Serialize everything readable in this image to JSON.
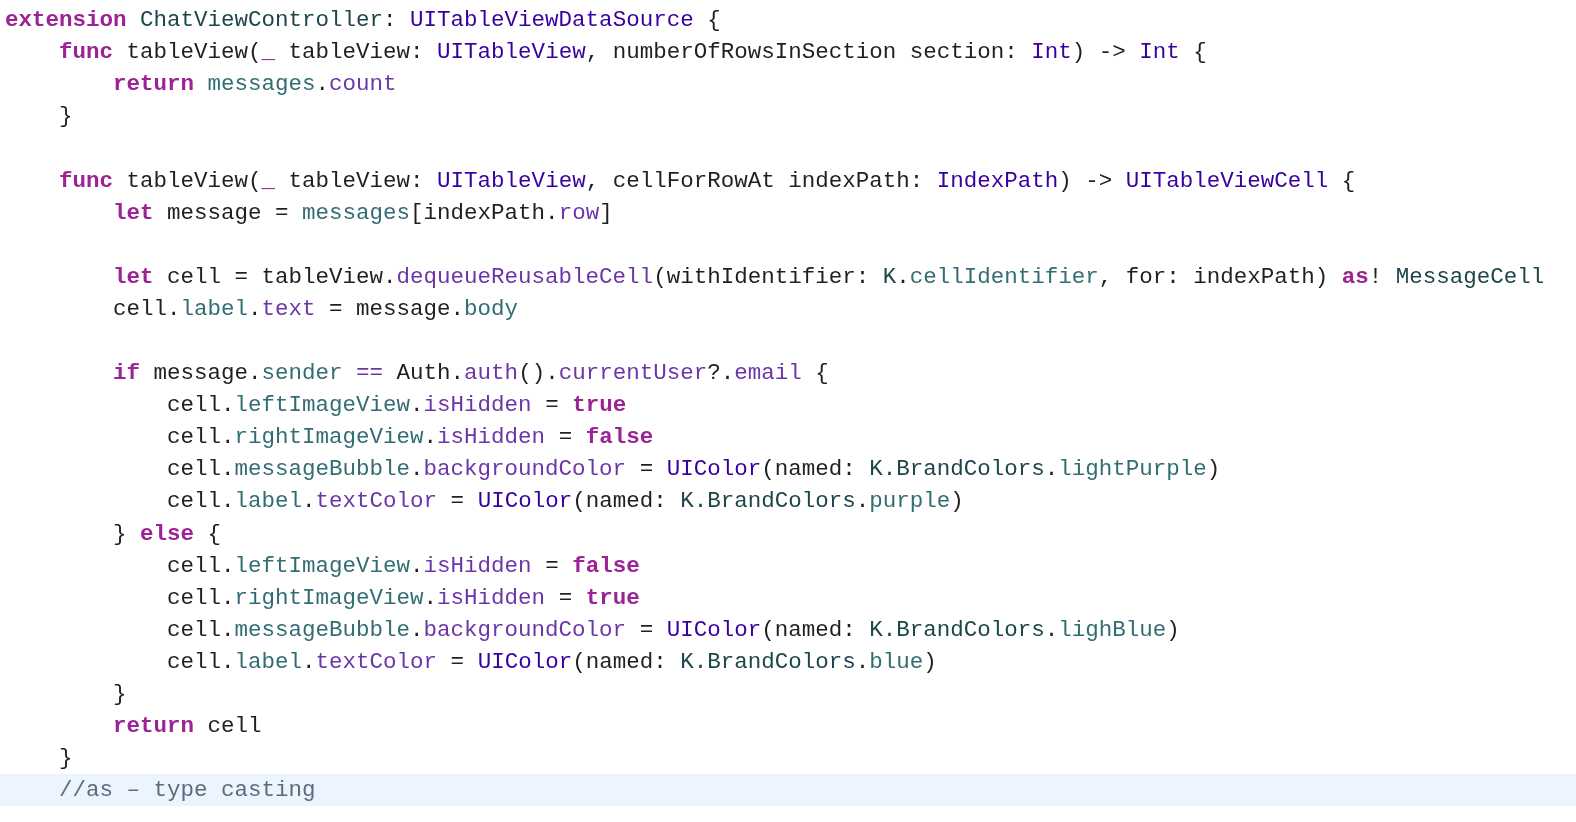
{
  "editor": {
    "lines": [
      {
        "current": false,
        "tokens": [
          {
            "kind": "keyword",
            "text": "extension"
          },
          {
            "kind": "project_type",
            "text": " ChatViewController"
          },
          {
            "kind": "plain",
            "text": ": "
          },
          {
            "kind": "system_type",
            "text": "UITableViewDataSource"
          },
          {
            "kind": "plain",
            "text": " {"
          }
        ]
      },
      {
        "current": false,
        "tokens": [
          {
            "kind": "keyword",
            "text": "    func"
          },
          {
            "kind": "plain",
            "text": " tableView("
          },
          {
            "kind": "keyword",
            "text": "_"
          },
          {
            "kind": "plain",
            "text": " tableView: "
          },
          {
            "kind": "system_type",
            "text": "UITableView"
          },
          {
            "kind": "plain",
            "text": ", numberOfRowsInSection section: "
          },
          {
            "kind": "system_type",
            "text": "Int"
          },
          {
            "kind": "plain",
            "text": ") -> "
          },
          {
            "kind": "system_type",
            "text": "Int"
          },
          {
            "kind": "plain",
            "text": " {"
          }
        ]
      },
      {
        "current": false,
        "tokens": [
          {
            "kind": "keyword",
            "text": "        return"
          },
          {
            "kind": "project_member",
            "text": " messages"
          },
          {
            "kind": "plain",
            "text": "."
          },
          {
            "kind": "system_member",
            "text": "count"
          }
        ]
      },
      {
        "current": false,
        "tokens": [
          {
            "kind": "plain",
            "text": "    }"
          }
        ]
      },
      {
        "current": false
      },
      {
        "current": false,
        "tokens": [
          {
            "kind": "keyword",
            "text": "    func"
          },
          {
            "kind": "plain",
            "text": " tableView("
          },
          {
            "kind": "keyword",
            "text": "_"
          },
          {
            "kind": "plain",
            "text": " tableView: "
          },
          {
            "kind": "system_type",
            "text": "UITableView"
          },
          {
            "kind": "plain",
            "text": ", cellForRowAt indexPath: "
          },
          {
            "kind": "system_type",
            "text": "IndexPath"
          },
          {
            "kind": "plain",
            "text": ") -> "
          },
          {
            "kind": "system_type",
            "text": "UITableViewCell"
          },
          {
            "kind": "plain",
            "text": " {"
          }
        ]
      },
      {
        "current": false,
        "tokens": [
          {
            "kind": "keyword",
            "text": "        let"
          },
          {
            "kind": "plain",
            "text": " message = "
          },
          {
            "kind": "project_member",
            "text": "messages"
          },
          {
            "kind": "plain",
            "text": "[indexPath."
          },
          {
            "kind": "system_member",
            "text": "row"
          },
          {
            "kind": "plain",
            "text": "]"
          }
        ]
      },
      {
        "current": false
      },
      {
        "current": false,
        "tokens": [
          {
            "kind": "keyword",
            "text": "        let"
          },
          {
            "kind": "plain",
            "text": " cell = tableView."
          },
          {
            "kind": "system_member",
            "text": "dequeueReusableCell"
          },
          {
            "kind": "plain",
            "text": "(withIdentifier: "
          },
          {
            "kind": "project_type",
            "text": "K"
          },
          {
            "kind": "plain",
            "text": "."
          },
          {
            "kind": "project_member",
            "text": "cellIdentifier"
          },
          {
            "kind": "plain",
            "text": ", for: indexPath) "
          },
          {
            "kind": "keyword",
            "text": "as"
          },
          {
            "kind": "plain",
            "text": "! "
          },
          {
            "kind": "project_type",
            "text": "MessageCell"
          }
        ]
      },
      {
        "current": false,
        "tokens": [
          {
            "kind": "plain",
            "text": "        cell."
          },
          {
            "kind": "project_member",
            "text": "label"
          },
          {
            "kind": "plain",
            "text": "."
          },
          {
            "kind": "system_member",
            "text": "text"
          },
          {
            "kind": "plain",
            "text": " = message."
          },
          {
            "kind": "project_member",
            "text": "body"
          }
        ]
      },
      {
        "current": false
      },
      {
        "current": false,
        "tokens": [
          {
            "kind": "keyword",
            "text": "        if"
          },
          {
            "kind": "plain",
            "text": " message."
          },
          {
            "kind": "project_member",
            "text": "sender"
          },
          {
            "kind": "system_member",
            "text": " =="
          },
          {
            "kind": "plain",
            "text": " Auth."
          },
          {
            "kind": "system_member",
            "text": "auth"
          },
          {
            "kind": "plain",
            "text": "()."
          },
          {
            "kind": "system_member",
            "text": "currentUser"
          },
          {
            "kind": "plain",
            "text": "?."
          },
          {
            "kind": "system_member",
            "text": "email"
          },
          {
            "kind": "plain",
            "text": " {"
          }
        ]
      },
      {
        "current": false,
        "tokens": [
          {
            "kind": "plain",
            "text": "            cell."
          },
          {
            "kind": "project_member",
            "text": "leftImageView"
          },
          {
            "kind": "plain",
            "text": "."
          },
          {
            "kind": "system_member",
            "text": "isHidden"
          },
          {
            "kind": "plain",
            "text": " = "
          },
          {
            "kind": "keyword",
            "text": "true"
          }
        ]
      },
      {
        "current": false,
        "tokens": [
          {
            "kind": "plain",
            "text": "            cell."
          },
          {
            "kind": "project_member",
            "text": "rightImageView"
          },
          {
            "kind": "plain",
            "text": "."
          },
          {
            "kind": "system_member",
            "text": "isHidden"
          },
          {
            "kind": "plain",
            "text": " = "
          },
          {
            "kind": "keyword",
            "text": "false"
          }
        ]
      },
      {
        "current": false,
        "tokens": [
          {
            "kind": "plain",
            "text": "            cell."
          },
          {
            "kind": "project_member",
            "text": "messageBubble"
          },
          {
            "kind": "plain",
            "text": "."
          },
          {
            "kind": "system_member",
            "text": "backgroundColor"
          },
          {
            "kind": "plain",
            "text": " = "
          },
          {
            "kind": "system_type",
            "text": "UIColor"
          },
          {
            "kind": "plain",
            "text": "(named: "
          },
          {
            "kind": "project_type",
            "text": "K.BrandColors"
          },
          {
            "kind": "plain",
            "text": "."
          },
          {
            "kind": "project_member",
            "text": "lightPurple"
          },
          {
            "kind": "plain",
            "text": ")"
          }
        ]
      },
      {
        "current": false,
        "tokens": [
          {
            "kind": "plain",
            "text": "            cell."
          },
          {
            "kind": "project_member",
            "text": "label"
          },
          {
            "kind": "plain",
            "text": "."
          },
          {
            "kind": "system_member",
            "text": "textColor"
          },
          {
            "kind": "plain",
            "text": " = "
          },
          {
            "kind": "system_type",
            "text": "UIColor"
          },
          {
            "kind": "plain",
            "text": "(named: "
          },
          {
            "kind": "project_type",
            "text": "K.BrandColors"
          },
          {
            "kind": "plain",
            "text": "."
          },
          {
            "kind": "project_member",
            "text": "purple"
          },
          {
            "kind": "plain",
            "text": ")"
          }
        ]
      },
      {
        "current": false,
        "tokens": [
          {
            "kind": "plain",
            "text": "        } "
          },
          {
            "kind": "keyword",
            "text": "else"
          },
          {
            "kind": "plain",
            "text": " {"
          }
        ]
      },
      {
        "current": false,
        "tokens": [
          {
            "kind": "plain",
            "text": "            cell."
          },
          {
            "kind": "project_member",
            "text": "leftImageView"
          },
          {
            "kind": "plain",
            "text": "."
          },
          {
            "kind": "system_member",
            "text": "isHidden"
          },
          {
            "kind": "plain",
            "text": " = "
          },
          {
            "kind": "keyword",
            "text": "false"
          }
        ]
      },
      {
        "current": false,
        "tokens": [
          {
            "kind": "plain",
            "text": "            cell."
          },
          {
            "kind": "project_member",
            "text": "rightImageView"
          },
          {
            "kind": "plain",
            "text": "."
          },
          {
            "kind": "system_member",
            "text": "isHidden"
          },
          {
            "kind": "plain",
            "text": " = "
          },
          {
            "kind": "keyword",
            "text": "true"
          }
        ]
      },
      {
        "current": false,
        "tokens": [
          {
            "kind": "plain",
            "text": "            cell."
          },
          {
            "kind": "project_member",
            "text": "messageBubble"
          },
          {
            "kind": "plain",
            "text": "."
          },
          {
            "kind": "system_member",
            "text": "backgroundColor"
          },
          {
            "kind": "plain",
            "text": " = "
          },
          {
            "kind": "system_type",
            "text": "UIColor"
          },
          {
            "kind": "plain",
            "text": "(named: "
          },
          {
            "kind": "project_type",
            "text": "K.BrandColors"
          },
          {
            "kind": "plain",
            "text": "."
          },
          {
            "kind": "project_member",
            "text": "lighBlue"
          },
          {
            "kind": "plain",
            "text": ")"
          }
        ]
      },
      {
        "current": false,
        "tokens": [
          {
            "kind": "plain",
            "text": "            cell."
          },
          {
            "kind": "project_member",
            "text": "label"
          },
          {
            "kind": "plain",
            "text": "."
          },
          {
            "kind": "system_member",
            "text": "textColor"
          },
          {
            "kind": "plain",
            "text": " = "
          },
          {
            "kind": "system_type",
            "text": "UIColor"
          },
          {
            "kind": "plain",
            "text": "(named: "
          },
          {
            "kind": "project_type",
            "text": "K.BrandColors"
          },
          {
            "kind": "plain",
            "text": "."
          },
          {
            "kind": "project_member",
            "text": "blue"
          },
          {
            "kind": "plain",
            "text": ")"
          }
        ]
      },
      {
        "current": false,
        "tokens": [
          {
            "kind": "plain",
            "text": "        }"
          }
        ]
      },
      {
        "current": false,
        "tokens": [
          {
            "kind": "keyword",
            "text": "        return"
          },
          {
            "kind": "plain",
            "text": " cell"
          }
        ]
      },
      {
        "current": false,
        "tokens": [
          {
            "kind": "plain",
            "text": "    }"
          }
        ]
      },
      {
        "current": true,
        "tokens": [
          {
            "kind": "comment",
            "text": "    //as – type casting"
          }
        ]
      }
    ]
  }
}
